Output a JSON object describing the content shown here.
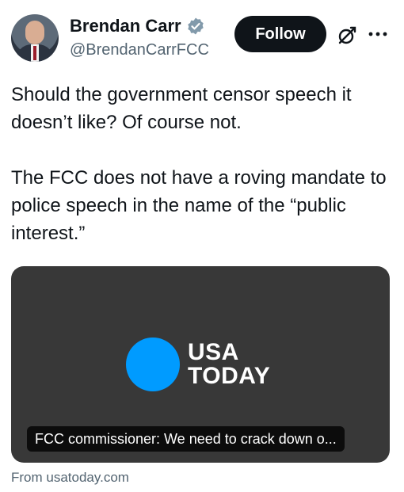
{
  "author": {
    "name": "Brendan Carr",
    "handle": "@BrendanCarrFCC",
    "verified": true
  },
  "actions": {
    "follow_label": "Follow",
    "icons": [
      "grok-icon",
      "more-icon"
    ]
  },
  "tweet": {
    "text": "Should the government censor speech it doesn’t like?  Of course not.\n\nThe FCC does not have a roving mandate to police speech in the name of the “public interest.”"
  },
  "card": {
    "logo_line1": "USA",
    "logo_line2": "TODAY",
    "headline": "FCC commissioner: We need to crack down o...",
    "source": "From usatoday.com",
    "logo_color": "#009bff",
    "background_color": "#383838"
  },
  "colors": {
    "text": "#0f1419",
    "secondary_text": "#536471",
    "verified_badge": "#829aab"
  }
}
